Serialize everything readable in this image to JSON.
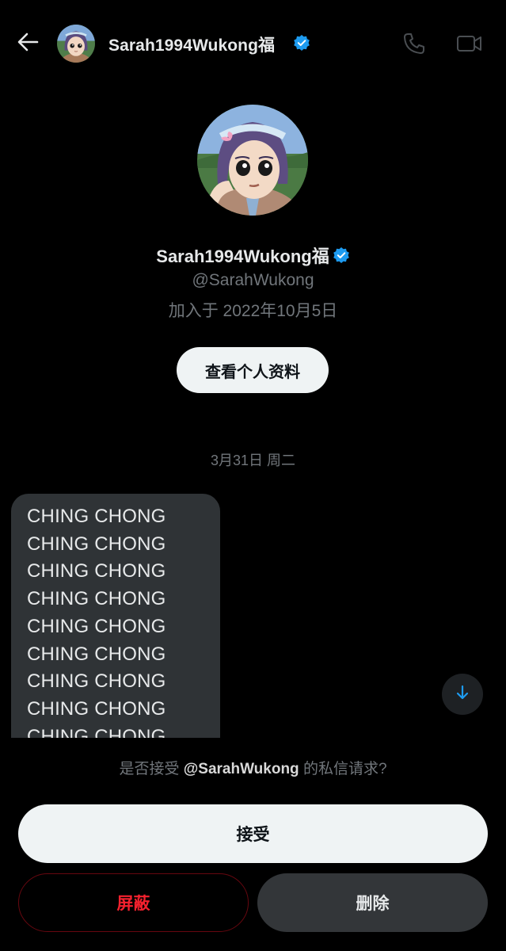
{
  "header": {
    "name": "Sarah1994Wukong福",
    "icons": [
      "back-arrow-icon",
      "verified-badge-icon",
      "phone-icon",
      "video-camera-icon"
    ]
  },
  "profile": {
    "name": "Sarah1994Wukong福",
    "handle": "@SarahWukong",
    "joined": "加入于 2022年10月5日",
    "view_profile_label": "查看个人资料"
  },
  "date_separator": "3月31日 周二",
  "message": {
    "lines": [
      "CHING CHONG",
      "CHING CHONG",
      "CHING CHONG",
      "CHING CHONG",
      "CHING CHONG",
      "CHING CHONG",
      "CHING CHONG",
      "CHING CHONG",
      "CHING CHONG"
    ]
  },
  "request": {
    "prefix": "是否接受 ",
    "handle": "@SarahWukong",
    "suffix": " 的私信请求?"
  },
  "actions": {
    "accept_label": "接受",
    "block_label": "屏蔽",
    "delete_label": "删除"
  },
  "colors": {
    "background": "#000000",
    "verified": "#1d9bf0",
    "danger": "#f4212e",
    "muted_text": "#71767b",
    "bubble": "#2f3336"
  }
}
